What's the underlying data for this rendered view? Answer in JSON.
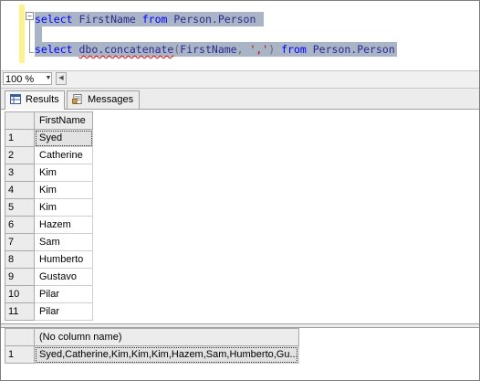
{
  "editor": {
    "line1": {
      "kw1": "select",
      "col": "FirstName",
      "kw2": "from",
      "table": "Person.Person"
    },
    "line2": {
      "kw1": "select",
      "func": "dbo.concatenate",
      "arg_col": "FirstName",
      "arg_str": "','",
      "kw2": "from",
      "table": "Person.Person"
    }
  },
  "zoom": {
    "value": "100 %"
  },
  "tabs": {
    "results": "Results",
    "messages": "Messages"
  },
  "grid1": {
    "columns": [
      "FirstName"
    ],
    "rows": [
      {
        "n": "1",
        "v": "Syed"
      },
      {
        "n": "2",
        "v": "Catherine"
      },
      {
        "n": "3",
        "v": "Kim"
      },
      {
        "n": "4",
        "v": "Kim"
      },
      {
        "n": "5",
        "v": "Kim"
      },
      {
        "n": "6",
        "v": "Hazem"
      },
      {
        "n": "7",
        "v": "Sam"
      },
      {
        "n": "8",
        "v": "Humberto"
      },
      {
        "n": "9",
        "v": "Gustavo"
      },
      {
        "n": "10",
        "v": "Pilar"
      },
      {
        "n": "11",
        "v": "Pilar"
      }
    ]
  },
  "grid2": {
    "columns": [
      "(No column name)"
    ],
    "rows": [
      {
        "n": "1",
        "v": "Syed,Catherine,Kim,Kim,Kim,Hazem,Sam,Humberto,Gu..."
      }
    ]
  }
}
